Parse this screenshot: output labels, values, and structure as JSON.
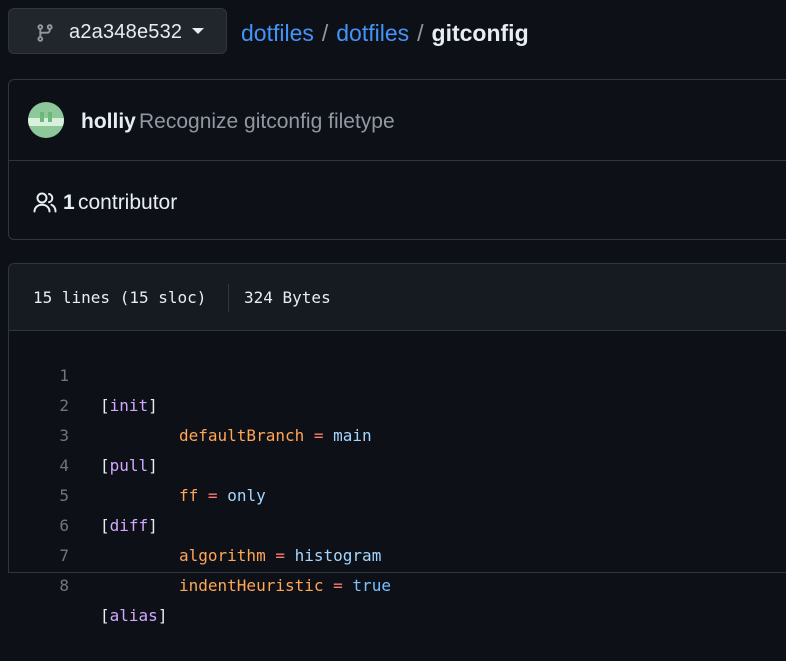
{
  "branch": {
    "name": "a2a348e532",
    "icon": "git-branch-icon"
  },
  "breadcrumb": {
    "repo_owner": "dotfiles",
    "repo_name": "dotfiles",
    "separator": "/",
    "file": "gitconfig"
  },
  "commit": {
    "author": "holliy",
    "message": "Recognize gitconfig filetype",
    "avatar_color": "#8ec89a"
  },
  "contributors": {
    "count": "1",
    "label": "contributor",
    "icon": "people-icon"
  },
  "file_info": {
    "lines": "15 lines (15 sloc)",
    "size": "324 Bytes"
  },
  "code_lines": [
    {
      "num": "1",
      "section": "init"
    },
    {
      "num": "2",
      "key": "defaultBranch",
      "value": "main"
    },
    {
      "num": "3",
      "section": "pull"
    },
    {
      "num": "4",
      "key": "ff",
      "value": "only"
    },
    {
      "num": "5",
      "section": "diff"
    },
    {
      "num": "6",
      "key": "algorithm",
      "value": "histogram"
    },
    {
      "num": "7",
      "key": "indentHeuristic",
      "value": "true"
    },
    {
      "num": "8",
      "section": "alias"
    }
  ],
  "colors": {
    "link": "#4493f8",
    "section": "#d2a8ff",
    "key": "#ffa657",
    "operator": "#ff7b72",
    "value": "#a5d6ff"
  }
}
